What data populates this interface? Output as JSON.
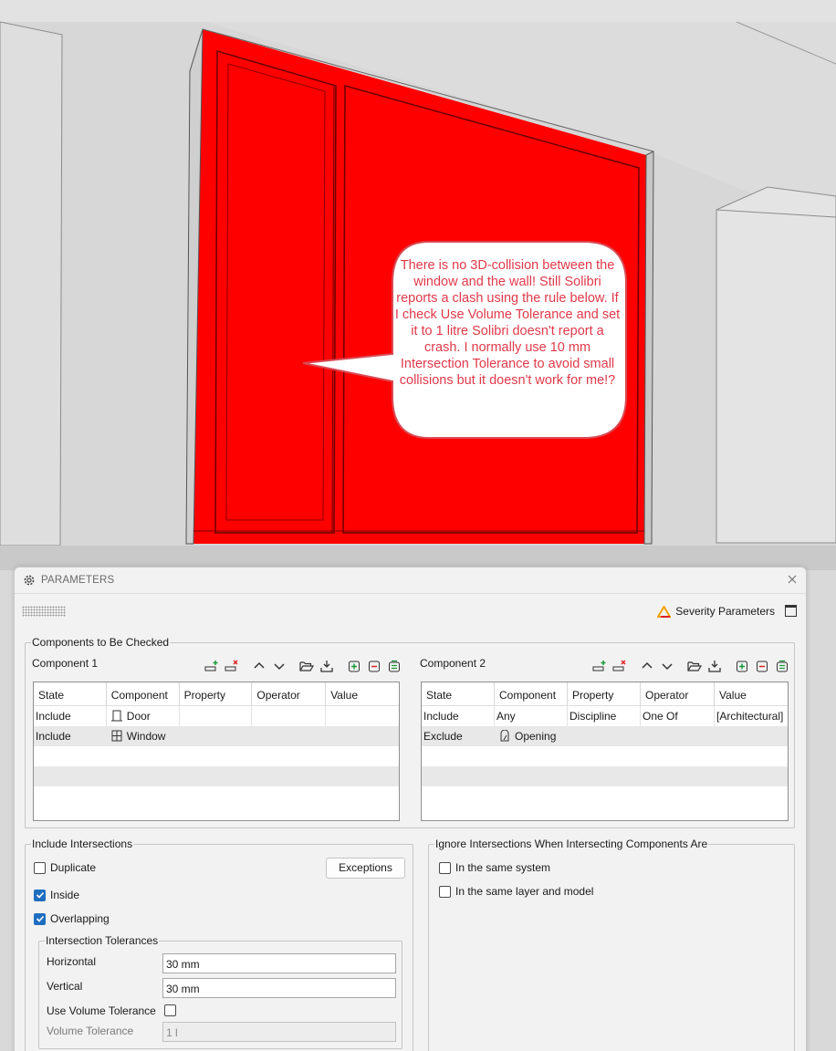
{
  "annotation": {
    "text": "There is no 3D-collision between the window and the wall! Still Solibri reports a clash using the rule below. If I check Use Volume Tolerance and set it to 1 litre Solibri doesn't report a crash. I normally use 10 mm Intersection Tolerance to avoid small collisions but it doesn't work for me!?",
    "color": "#e0394a"
  },
  "viewport": {
    "highlight_color": "#ff0000",
    "background_color": "#d9d9d9"
  },
  "dialog": {
    "title": "PARAMETERS",
    "severity_label": "Severity Parameters",
    "components_group": "Components to Be Checked",
    "component1": {
      "label": "Component 1",
      "columns": [
        "State",
        "Component",
        "Property",
        "Operator",
        "Value"
      ],
      "rows": [
        {
          "state": "Include",
          "component": "Door",
          "icon": "door-icon",
          "property": "",
          "operator": "",
          "value": ""
        },
        {
          "state": "Include",
          "component": "Window",
          "icon": "window-icon",
          "property": "",
          "operator": "",
          "value": ""
        }
      ]
    },
    "component2": {
      "label": "Component 2",
      "columns": [
        "State",
        "Component",
        "Property",
        "Operator",
        "Value"
      ],
      "rows": [
        {
          "state": "Include",
          "component": "Any",
          "icon": "",
          "property": "Discipline",
          "operator": "One Of",
          "value": "[Architectural]"
        },
        {
          "state": "Exclude",
          "component": "Opening",
          "icon": "opening-icon",
          "property": "",
          "operator": "",
          "value": ""
        }
      ]
    },
    "include_group": "Include Intersections",
    "exceptions_label": "Exceptions",
    "duplicate_label": "Duplicate",
    "duplicate_checked": false,
    "inside_label": "Inside",
    "inside_checked": true,
    "overlapping_label": "Overlapping",
    "overlapping_checked": true,
    "tolerances_group": "Intersection Tolerances",
    "horizontal_label": "Horizontal",
    "horizontal_value": "30 mm",
    "vertical_label": "Vertical",
    "vertical_value": "30 mm",
    "use_volume_label": "Use Volume Tolerance",
    "use_volume_checked": false,
    "volume_label": "Volume Tolerance",
    "volume_value": "1 l",
    "ignore_group": "Ignore Intersections When Intersecting Components Are",
    "same_system_label": "In the same system",
    "same_system_checked": false,
    "same_layer_label": "In the same layer and model",
    "same_layer_checked": false
  }
}
